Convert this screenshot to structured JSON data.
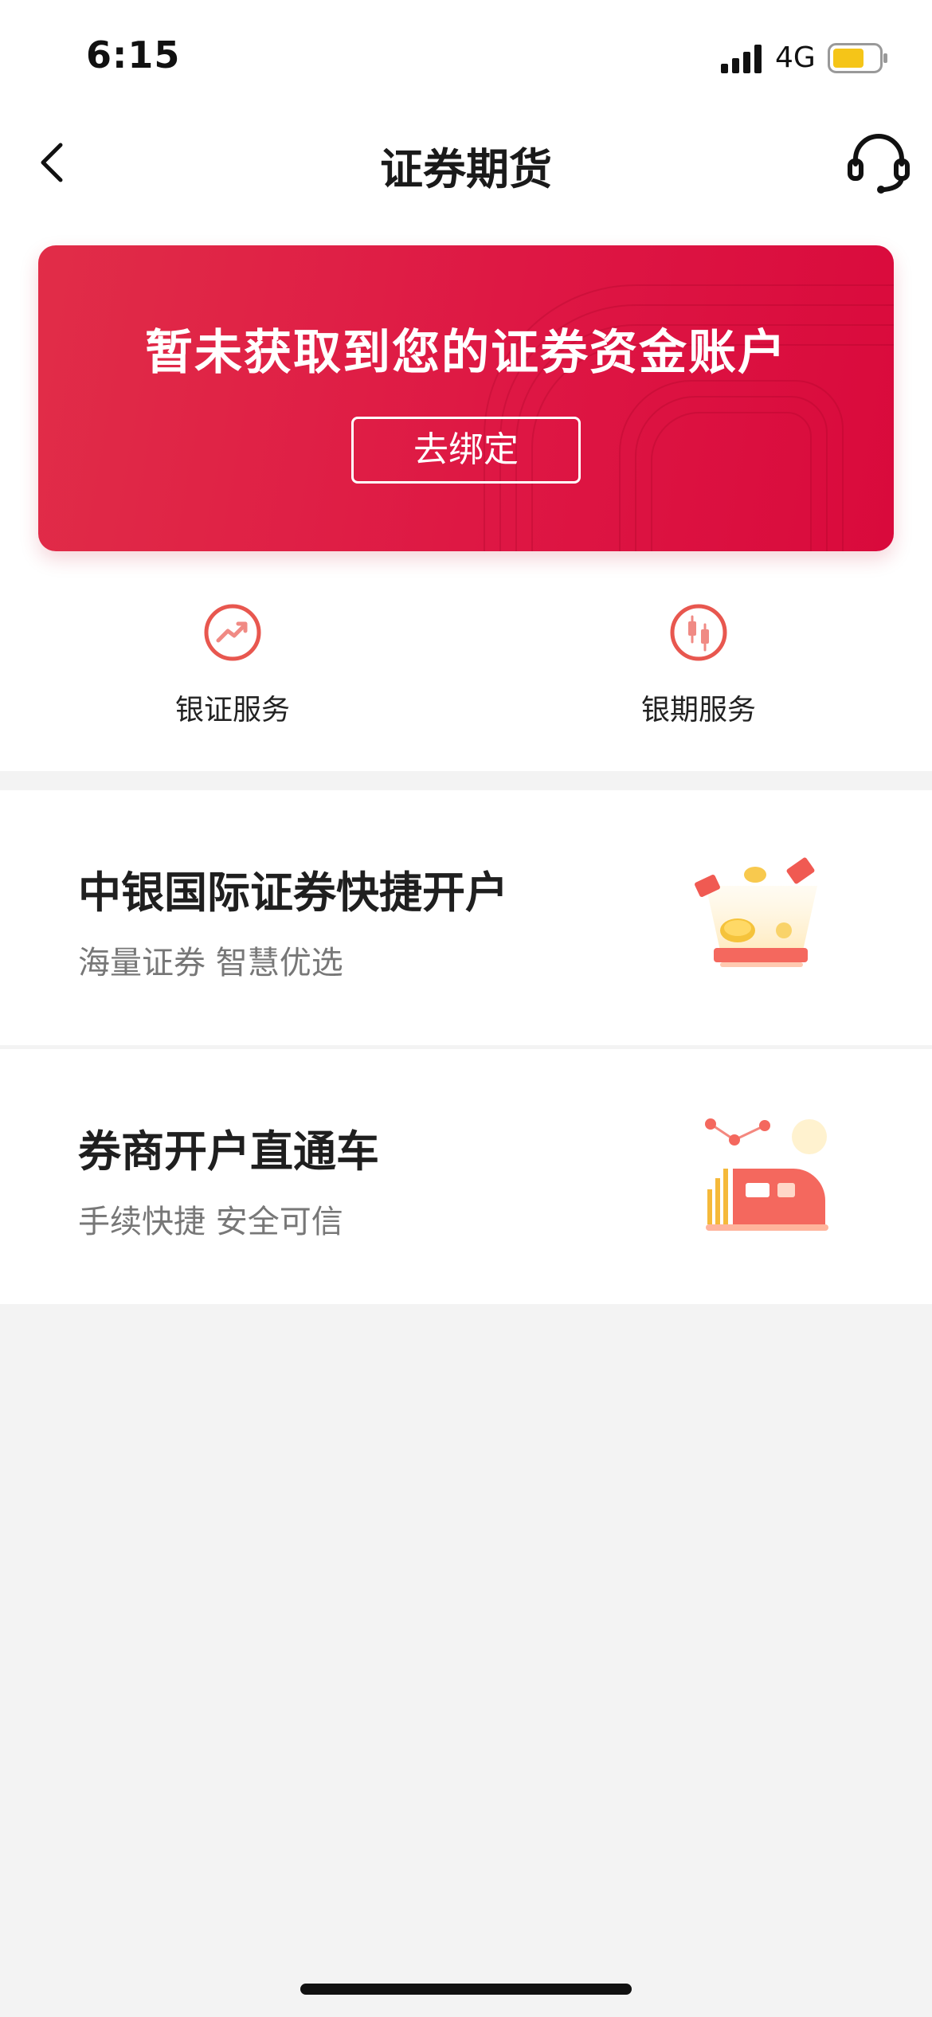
{
  "status_bar": {
    "time": "6:15",
    "network": "4G",
    "battery_color": "#f5c518"
  },
  "nav": {
    "title": "证券期货",
    "back_icon": "chevron-left-icon",
    "service_icon": "headset-icon"
  },
  "banner": {
    "title": "暂未获取到您的证券资金账户",
    "button_label": "去绑定",
    "color": "#de1744"
  },
  "quick_services": [
    {
      "label": "银证服务",
      "icon": "trend-up-icon"
    },
    {
      "label": "银期服务",
      "icon": "candlestick-icon"
    }
  ],
  "cards": [
    {
      "title": "中银国际证券快捷开户",
      "subtitle": "海量证券 智慧优选",
      "icon": "coins-illustration"
    },
    {
      "title": "券商开户直通车",
      "subtitle": "手续快捷 安全可信",
      "icon": "train-chart-illustration"
    }
  ],
  "accent_color": "#e8574f"
}
